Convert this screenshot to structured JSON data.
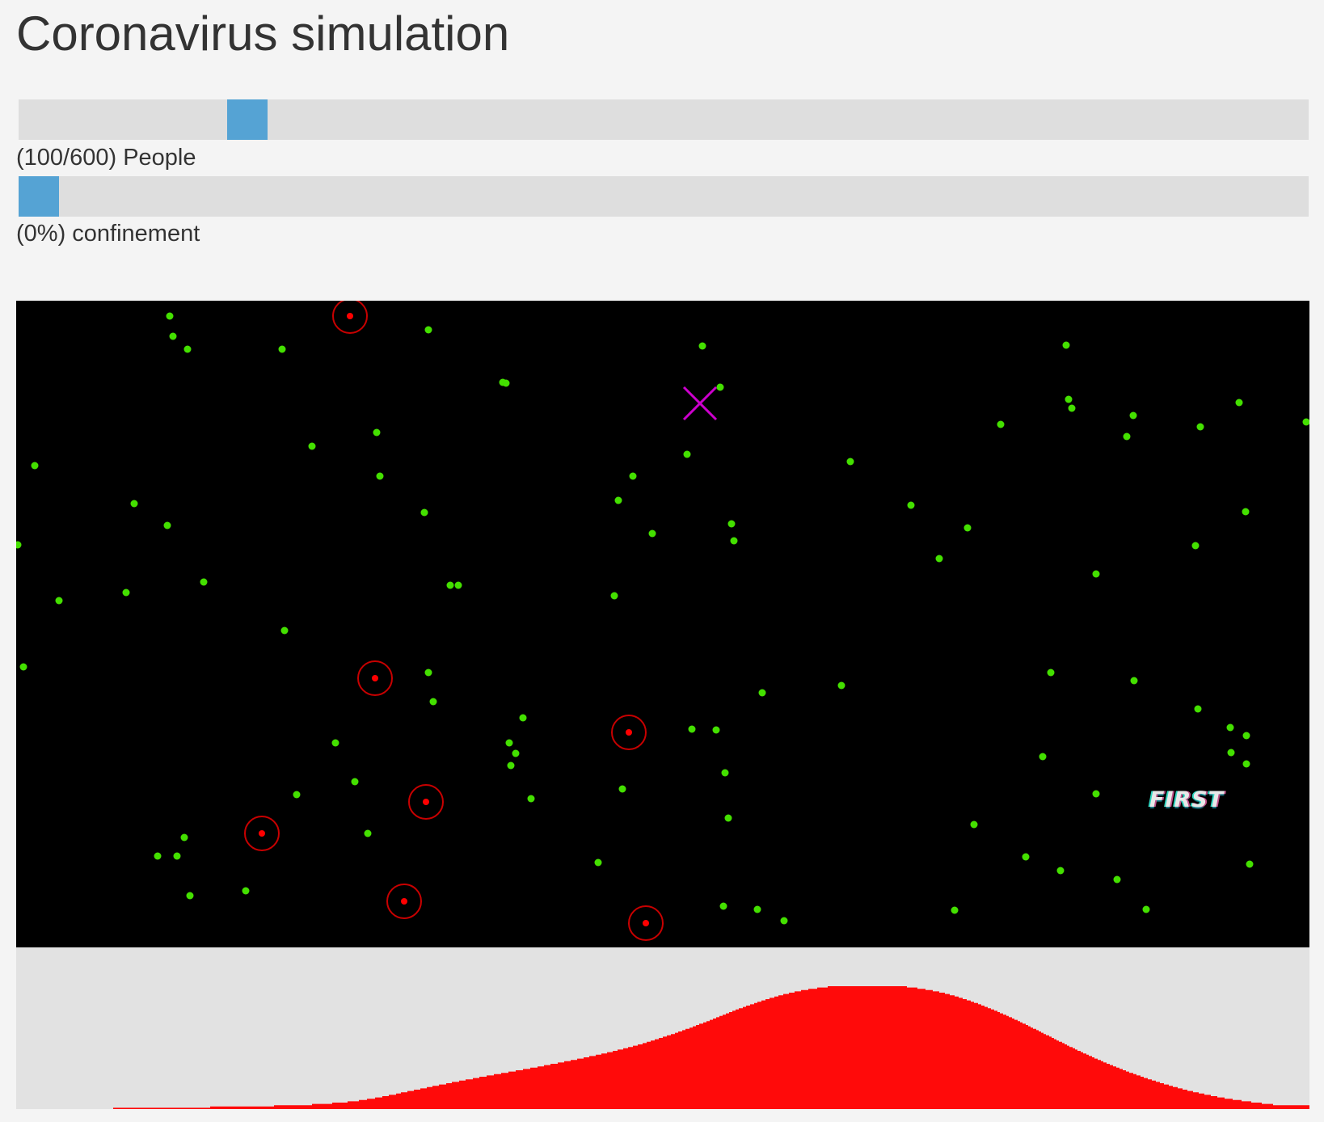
{
  "page": {
    "title": "Coronavirus simulation"
  },
  "controls": {
    "people": {
      "label": "(100/600) People",
      "value": 100,
      "max": 600
    },
    "confinement": {
      "label": "(0%) confinement",
      "value": 0,
      "max": 100
    }
  },
  "colors": {
    "page_background": "#f4f4f4",
    "slider_track": "#dedede",
    "slider_thumb": "#55a3d4",
    "simulation_background": "#000000",
    "healthy": "#44e000",
    "infected": "#ff0000",
    "infection_ring": "#c80000",
    "marker": "#cc00cc",
    "graph_background": "#e2e2e2",
    "graph_fill": "#ff0a0a"
  },
  "simulation": {
    "tag_text": "FIRST",
    "marker_icon": "x-mark-icon",
    "healthy_count": 100,
    "infected_count": 7
  },
  "chart_data": {
    "type": "area",
    "values": [
      0,
      0,
      0,
      0,
      0,
      0,
      0,
      0,
      0,
      0,
      0,
      0,
      0,
      0,
      0,
      0,
      0,
      0,
      0,
      0,
      0,
      0,
      0,
      0,
      0,
      0,
      0,
      0,
      0,
      0,
      0,
      0,
      0,
      0,
      0,
      0,
      0,
      0,
      0,
      0,
      0,
      0,
      0,
      0,
      0,
      0,
      0,
      0,
      0,
      0,
      0,
      0,
      0,
      0,
      0,
      0,
      0,
      0,
      0,
      0,
      0,
      0,
      0,
      0,
      0,
      0,
      0,
      0,
      0,
      0,
      0,
      0,
      0,
      0,
      0,
      0,
      0,
      0,
      0,
      0,
      0,
      0,
      0,
      0,
      0,
      0,
      0,
      0,
      0,
      0,
      0,
      0,
      0,
      0,
      0,
      0,
      0,
      0,
      0,
      0,
      0,
      0,
      0,
      0,
      0,
      0,
      0,
      0,
      0,
      0,
      0,
      0,
      0,
      0,
      0,
      0,
      0,
      0,
      0,
      0,
      1,
      1,
      1,
      1,
      1,
      1,
      1,
      1,
      1,
      1,
      1,
      1,
      1,
      1,
      1,
      1,
      1,
      1,
      1,
      1,
      1,
      1,
      1,
      1,
      1,
      1,
      1,
      1,
      1,
      1,
      1,
      1,
      1,
      1,
      1,
      1,
      1,
      1,
      1,
      1,
      1,
      1,
      1,
      1,
      1,
      1,
      1,
      1,
      1,
      1,
      1,
      1,
      1,
      1,
      1,
      1,
      1,
      1,
      1,
      1,
      1,
      1,
      1,
      1,
      1,
      1,
      1,
      1,
      1,
      1,
      1,
      1,
      1,
      1,
      1,
      1,
      1,
      1,
      1,
      1,
      1,
      1,
      1,
      1,
      1,
      1,
      1,
      1,
      1,
      1,
      1,
      1,
      1,
      1,
      1,
      1,
      1,
      1,
      1,
      1,
      1,
      1,
      1,
      1,
      1,
      1,
      1,
      1,
      1,
      1,
      1,
      1,
      1,
      1,
      1,
      1,
      1,
      1,
      1,
      1,
      2,
      2,
      2,
      2,
      2,
      2,
      2,
      2,
      2,
      2,
      2,
      2,
      2,
      2,
      2,
      2,
      2,
      2,
      2,
      2,
      2,
      2,
      2,
      2,
      2,
      2,
      2,
      2,
      2,
      2,
      2,
      2,
      2,
      2,
      2,
      2,
      2,
      2,
      2,
      2,
      2,
      2,
      2,
      2,
      2,
      2,
      2,
      2,
      2,
      2,
      2,
      2,
      2,
      2,
      2,
      2,
      2,
      2,
      2,
      2,
      2,
      2,
      2,
      2,
      2,
      2,
      2,
      2,
      2,
      2,
      2,
      2,
      2,
      2,
      2,
      2,
      2,
      2,
      2,
      3,
      3,
      3,
      3,
      3,
      3,
      3,
      3,
      3,
      3,
      3,
      3,
      3,
      3,
      3,
      3,
      3,
      3,
      3,
      3,
      3,
      3,
      3,
      3,
      3,
      3,
      3,
      3,
      3,
      3,
      3,
      3,
      3,
      3,
      3,
      3,
      3,
      3,
      3,
      3,
      3,
      3,
      3,
      3,
      3,
      3,
      3,
      4,
      4,
      4,
      4,
      4,
      4,
      4,
      4,
      4,
      4,
      4,
      4,
      4,
      4,
      4,
      4,
      4,
      4,
      4,
      4,
      4,
      4,
      4,
      4,
      4,
      5,
      5,
      5,
      5,
      5,
      5,
      5,
      5,
      5,
      5,
      5,
      5,
      5,
      5,
      5,
      5,
      5,
      5,
      5,
      6,
      6,
      6,
      6,
      6,
      6,
      6,
      6,
      6,
      6,
      6,
      6,
      6,
      6,
      7,
      7,
      7,
      7,
      7,
      7,
      7,
      7,
      7,
      7,
      8,
      8,
      8,
      8,
      8,
      8,
      8,
      8,
      8,
      8,
      9,
      9,
      9,
      9,
      9,
      9,
      9,
      9,
      9,
      10,
      10,
      10,
      10,
      10,
      10,
      10,
      10,
      11,
      11,
      11,
      11,
      11,
      11,
      11,
      11,
      11,
      12,
      12,
      12,
      12,
      12,
      12,
      13,
      13,
      13,
      13,
      13,
      13,
      13,
      13,
      14,
      14,
      14,
      14,
      14,
      14,
      14,
      14,
      15,
      15,
      15,
      15,
      15,
      15,
      15,
      15,
      16,
      16,
      16,
      16,
      16,
      16,
      16,
      16,
      17,
      17,
      17,
      17,
      17,
      17,
      17,
      18,
      18,
      18,
      18,
      18,
      18,
      18,
      18,
      19,
      19,
      19,
      19,
      19,
      19,
      19,
      19,
      19,
      20,
      20,
      20,
      20,
      20,
      20,
      20,
      21,
      21,
      21,
      21,
      21,
      21,
      21,
      21,
      21,
      22,
      22,
      22,
      22,
      22,
      22,
      22,
      22,
      23,
      23,
      23,
      23,
      23,
      23,
      23,
      23,
      23,
      24,
      24,
      24,
      24,
      24,
      24,
      24,
      24,
      25,
      25,
      25,
      25,
      25,
      25,
      25,
      25,
      25,
      26,
      26,
      26,
      26,
      26,
      26,
      26,
      26,
      26,
      27,
      27,
      27,
      27,
      27,
      27,
      27,
      27,
      27,
      28,
      28,
      28,
      28,
      28,
      28,
      28,
      28,
      28,
      29,
      29,
      29,
      29,
      29,
      29,
      29,
      29,
      29,
      30,
      30,
      30,
      30,
      30,
      30,
      30,
      30,
      30,
      31,
      31,
      31,
      31,
      31,
      31,
      31,
      31,
      31,
      32,
      32,
      32,
      32,
      32,
      32,
      32,
      32,
      32,
      33,
      33,
      33,
      33,
      33,
      33,
      33,
      33,
      34,
      34,
      34,
      34,
      34,
      34,
      34,
      34,
      35,
      35,
      35,
      35,
      35,
      35,
      35,
      35,
      35,
      36,
      36,
      36,
      36,
      36,
      36,
      36,
      36,
      37,
      37,
      37,
      37,
      37,
      37,
      37,
      37,
      38,
      38,
      38,
      38,
      38,
      38,
      38,
      38,
      39,
      39,
      39,
      39,
      39,
      39,
      39,
      39,
      40,
      40,
      40,
      40,
      40,
      40,
      40,
      41,
      41,
      41,
      41,
      41,
      41,
      41,
      41,
      42,
      42,
      42,
      42,
      42,
      42,
      42,
      43,
      43,
      43,
      43,
      43,
      43,
      43,
      44,
      44,
      44,
      44,
      44,
      44,
      44,
      45,
      45,
      45,
      45,
      45,
      45,
      46,
      46,
      46,
      46,
      46,
      46,
      46,
      47,
      47,
      47,
      47,
      47,
      47,
      48,
      48,
      48,
      48,
      48,
      48,
      49,
      49,
      49,
      49,
      49,
      49,
      50,
      50,
      50,
      50,
      50,
      50,
      51,
      51,
      51,
      51,
      51,
      52,
      52,
      52,
      52,
      52,
      53,
      53,
      53,
      53,
      53,
      54,
      54,
      54,
      54,
      54,
      55,
      55,
      55,
      55,
      55,
      56,
      56,
      56,
      56,
      56,
      57,
      57,
      57,
      57,
      57,
      58,
      58,
      58,
      58,
      58,
      59,
      59,
      59,
      59,
      60,
      60,
      60,
      60,
      60,
      61,
      61,
      61,
      61,
      62,
      62,
      62,
      62,
      62,
      63,
      63,
      63,
      63,
      64,
      64,
      64,
      64,
      65,
      65,
      65,
      65,
      66,
      66,
      66,
      66,
      66,
      67,
      67,
      67,
      67,
      68,
      68,
      68,
      68,
      69,
      69,
      69,
      69,
      70,
      70,
      70,
      70,
      71,
      71,
      71,
      71,
      72,
      72,
      72,
      72,
      73,
      73,
      73,
      73,
      74,
      74,
      74,
      74,
      75,
      75,
      75,
      75,
      76,
      76,
      76,
      76,
      77,
      77,
      77,
      77,
      78,
      78,
      78,
      78,
      78,
      79,
      79,
      79,
      79,
      80,
      80,
      80,
      80,
      80,
      81,
      81,
      81,
      81,
      81,
      82,
      82,
      82,
      82,
      83,
      83,
      83,
      83,
      83,
      84,
      84,
      84,
      84,
      84,
      85,
      85,
      85,
      85,
      85,
      86,
      86,
      86,
      86,
      86,
      86,
      87,
      87,
      87,
      87,
      87,
      88,
      88,
      88,
      88,
      88,
      88,
      89,
      89,
      89,
      89,
      89,
      89,
      89,
      90,
      90,
      90,
      90,
      90,
      90,
      90,
      91,
      91,
      91,
      91,
      91,
      91,
      91,
      91,
      92,
      92,
      92,
      92,
      92,
      92,
      92,
      92,
      92,
      93,
      93,
      93,
      93,
      93,
      93,
      93,
      93,
      93,
      93,
      93,
      94,
      94,
      94,
      94,
      94,
      94,
      94,
      94,
      94,
      94,
      94,
      94,
      94,
      95,
      95,
      95,
      95,
      95,
      95,
      95,
      95,
      95,
      95,
      95,
      95,
      95,
      95,
      95,
      95,
      95,
      95,
      95,
      95,
      95,
      95,
      95,
      95,
      95,
      95,
      95,
      95,
      95,
      95,
      95,
      95,
      95,
      95,
      95,
      95,
      95,
      95,
      95,
      95,
      95,
      95,
      95,
      95,
      95,
      95,
      95,
      95,
      95,
      95,
      95,
      95,
      95,
      95,
      95,
      95,
      95,
      95,
      95,
      95,
      95,
      95,
      95,
      95,
      95,
      95,
      95,
      95,
      95,
      95,
      95,
      95,
      95,
      95,
      95,
      95,
      95,
      95,
      95,
      95,
      95,
      95,
      95,
      95,
      95,
      95,
      95,
      95,
      95,
      95,
      95,
      95,
      95,
      95,
      95,
      95,
      95,
      95,
      94,
      94,
      94,
      94,
      94,
      94,
      94,
      94,
      94,
      94,
      94,
      94,
      94,
      93,
      93,
      93,
      93,
      93,
      93,
      93,
      93,
      93,
      93,
      92,
      92,
      92,
      92,
      92,
      92,
      92,
      92,
      92,
      91,
      91,
      91,
      91,
      91,
      91,
      91,
      91,
      90,
      90,
      90,
      90,
      90,
      90,
      90,
      89,
      89,
      89,
      89,
      89,
      89,
      88,
      88,
      88,
      88,
      88,
      88,
      87,
      87,
      87,
      87,
      87,
      86,
      86,
      86,
      86,
      86,
      85,
      85,
      85,
      85,
      85,
      84,
      84,
      84,
      84,
      84,
      83,
      83,
      83,
      83,
      82,
      82,
      82,
      82,
      82,
      81,
      81,
      81,
      81,
      80,
      80,
      80,
      80,
      79,
      79,
      79,
      79,
      78,
      78,
      78,
      78,
      77,
      77,
      77,
      77,
      76,
      76,
      76,
      76,
      75,
      75,
      75,
      74,
      74,
      74,
      74,
      73,
      73,
      73,
      73,
      72,
      72,
      72,
      71,
      71,
      71,
      71,
      70,
      70,
      70,
      69,
      69,
      69,
      69,
      68,
      68,
      68,
      67,
      67,
      67,
      66,
      66,
      66,
      66,
      65,
      65,
      65,
      64,
      64,
      64,
      63,
      63,
      63,
      62,
      62,
      62,
      62,
      61,
      61,
      61,
      60,
      60,
      60,
      59,
      59,
      59,
      58,
      58,
      58,
      57,
      57,
      57,
      57,
      56,
      56,
      56,
      55,
      55,
      55,
      54,
      54,
      54,
      53,
      53,
      53,
      52,
      52,
      52,
      52,
      51,
      51,
      51,
      50,
      50,
      50,
      49,
      49,
      49,
      48,
      48,
      48,
      48,
      47,
      47,
      47,
      46,
      46,
      46,
      45,
      45,
      45,
      45,
      44,
      44,
      44,
      43,
      43,
      43,
      43,
      42,
      42,
      42,
      41,
      41,
      41,
      41,
      40,
      40,
      40,
      39,
      39,
      39,
      39,
      38,
      38,
      38,
      38,
      37,
      37,
      37,
      36,
      36,
      36,
      36,
      35,
      35,
      35,
      35,
      34,
      34,
      34,
      34,
      33,
      33,
      33,
      33,
      32,
      32,
      32,
      32,
      31,
      31,
      31,
      31,
      30,
      30,
      30,
      30,
      29,
      29,
      29,
      29,
      28,
      28,
      28,
      28,
      28,
      27,
      27,
      27,
      27,
      26,
      26,
      26,
      26,
      26,
      25,
      25,
      25,
      25,
      24,
      24,
      24,
      24,
      24,
      23,
      23,
      23,
      23,
      23,
      22,
      22,
      22,
      22,
      22,
      21,
      21,
      21,
      21,
      21,
      20,
      20,
      20,
      20,
      20,
      19,
      19,
      19,
      19,
      19,
      19,
      18,
      18,
      18,
      18,
      18,
      17,
      17,
      17,
      17,
      17,
      17,
      16,
      16,
      16,
      16,
      16,
      16,
      15,
      15,
      15,
      15,
      15,
      15,
      14,
      14,
      14,
      14,
      14,
      14,
      14,
      13,
      13,
      13,
      13,
      13,
      13,
      13,
      12,
      12,
      12,
      12,
      12,
      12,
      12,
      11,
      11,
      11,
      11,
      11,
      11,
      11,
      11,
      10,
      10,
      10,
      10,
      10,
      10,
      10,
      10,
      9,
      9,
      9,
      9,
      9,
      9,
      9,
      9,
      9,
      8,
      8,
      8,
      8,
      8,
      8,
      8,
      8,
      8,
      8,
      7,
      7,
      7,
      7,
      7,
      7,
      7,
      7,
      7,
      7,
      7,
      6,
      6,
      6,
      6,
      6,
      6,
      6,
      6,
      6,
      6,
      6,
      6,
      5,
      5,
      5,
      5,
      5,
      5,
      5,
      5,
      5,
      5,
      5,
      5,
      5,
      4,
      4,
      4,
      4,
      4,
      4,
      4,
      4,
      4,
      4,
      4,
      4,
      4,
      4,
      3,
      3,
      3,
      3,
      3,
      3,
      3,
      3,
      3,
      3,
      3,
      3,
      3,
      3,
      3,
      3,
      3,
      3,
      3,
      3,
      3,
      3,
      3,
      3,
      3,
      3,
      3,
      3,
      3,
      3,
      3,
      3,
      3,
      3,
      3,
      3,
      3,
      3,
      3,
      3,
      3,
      3,
      3,
      3,
      3,
      3,
      3,
      3,
      3,
      3,
      3,
      3,
      3,
      3,
      3
    ],
    "ylim": [
      0,
      100
    ],
    "fill": "#ff0a0a"
  }
}
